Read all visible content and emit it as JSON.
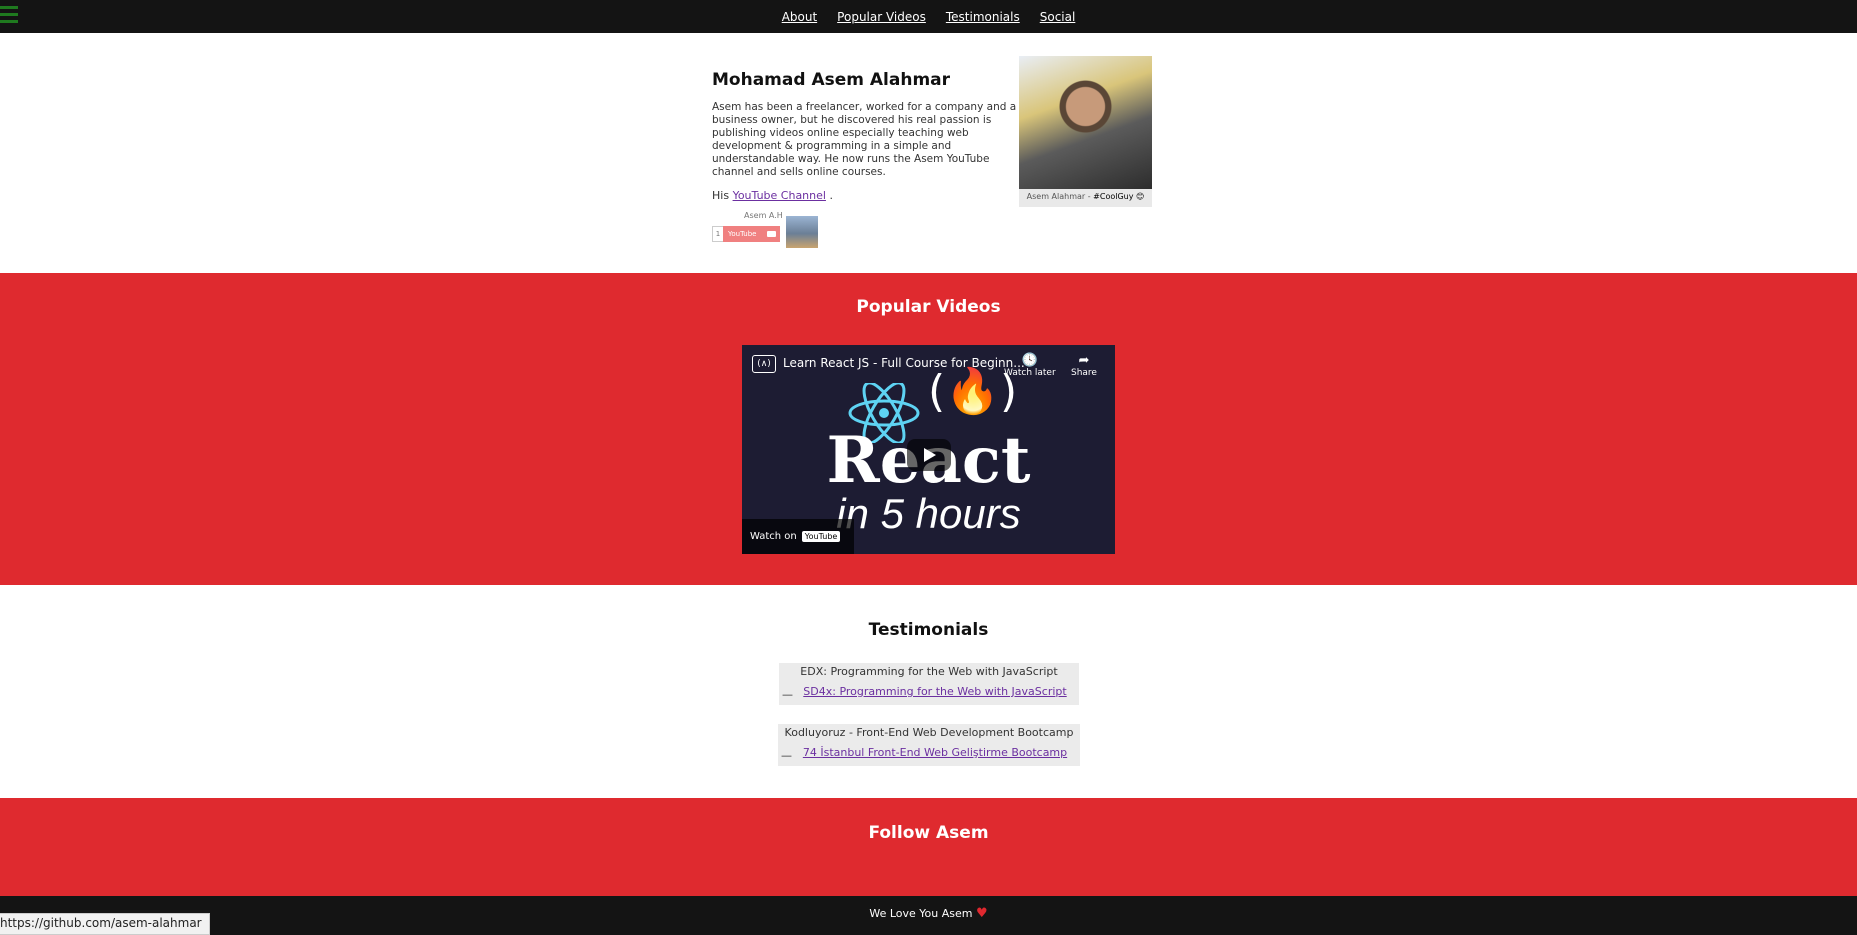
{
  "nav": {
    "links": [
      "About",
      "Popular Videos",
      "Testimonials",
      "Social"
    ]
  },
  "about": {
    "name": "Mohamad Asem Alahmar",
    "bio": "Asem has been a freelancer, worked for a company and a business owner, but he discovered his real passion is publishing videos online especially teaching web development & programming in a simple and understandable way. He now runs the Asem YouTube channel and sells online courses.",
    "youtube_prefix": "His",
    "youtube_link": "YouTube Channel",
    "youtube_suffix": ".",
    "subscribe_widget": {
      "channel_name": "Asem A.H",
      "count": "1",
      "button_label": "YouTube"
    },
    "photo_caption_name": "Asem Alahmar - ",
    "photo_caption_tag": "#CoolGuy 😊"
  },
  "popular_videos": {
    "title": "Popular Videos",
    "video": {
      "title": "Learn React JS - Full Course for Beginn...",
      "watch_later": "Watch later",
      "share": "Share",
      "logo_text": "(∧)",
      "thumb_logo": "(🔥)",
      "thumb_line1": "React",
      "thumb_line2": "in 5 hours",
      "watch_on": "Watch on",
      "youtube": "YouTube"
    }
  },
  "testimonials": {
    "title": "Testimonials",
    "items": [
      {
        "quote": "EDX: Programming for the Web with JavaScript",
        "dash": "—",
        "source": "SD4x: Programming for the Web with JavaScript"
      },
      {
        "quote": "Kodluyoruz - Front-End Web Development Bootcamp",
        "dash": "—",
        "source": "74 İstanbul Front-End Web Geliştirme Bootcamp"
      }
    ]
  },
  "follow": {
    "title": "Follow Asem"
  },
  "footer": {
    "text": "We Love You Asem",
    "heart": "♥"
  },
  "status_bar": {
    "url": "https://github.com/asem-alahmar"
  },
  "colors": {
    "accent_red": "#df2a2f",
    "nav_bg": "#141414",
    "link_purple": "#6b2fa0"
  }
}
